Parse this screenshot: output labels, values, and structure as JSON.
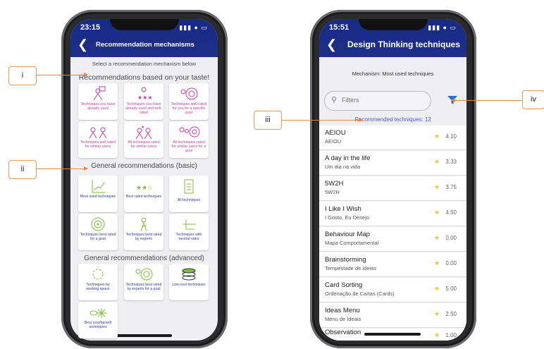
{
  "left": {
    "status_time": "23:15",
    "status_icons": "▮▮▮ ● ▭",
    "header_title": "Recommendation mechanisms",
    "intro": "Select a recommendation mechanism below",
    "section1": "Recommendations based on your taste!",
    "section2": "General recommendations (basic)",
    "section3": "General recommendations (advanced)",
    "cards1": [
      {
        "label": "Techniques you have already used",
        "icon": "person-list-icon"
      },
      {
        "label": "Techniques you have already used and well-rated",
        "icon": "person-stars-icon"
      },
      {
        "label": "Techniques well-rated for you for a specific goal",
        "icon": "person-target-icon"
      },
      {
        "label": "Techniques well-rated for similar users",
        "icon": "users-up-icon"
      },
      {
        "label": "All techniques rated for similar users",
        "icon": "users-stars-icon"
      },
      {
        "label": "All techniques rated for similar users for a goal",
        "icon": "users-target-icon"
      }
    ],
    "cards2": [
      {
        "label": "Most used techniques",
        "icon": "trend-chart-icon"
      },
      {
        "label": "Best rated techniques",
        "icon": "stars-icon"
      },
      {
        "label": "All techniques",
        "icon": "clipboard-list-icon"
      },
      {
        "label": "Techniques best rated for a goal",
        "icon": "target-icon"
      },
      {
        "label": "Techniques best rated by experts",
        "icon": "expert-icon"
      },
      {
        "label": "Techniques with neutral rates",
        "icon": "neutral-icon"
      }
    ],
    "cards3": [
      {
        "label": "Techniques by working space",
        "icon": "workspace-icon"
      },
      {
        "label": "Techniques best rated by experts for a goal",
        "icon": "experts-goal-icon"
      },
      {
        "label": "Low-cost techniques",
        "icon": "coins-icon"
      },
      {
        "label": "Best cost/benefit techniques",
        "icon": "cost-benefit-icon"
      }
    ]
  },
  "right": {
    "status_time": "15:51",
    "status_icons": "▮▮▮ ● ▭",
    "header_title": "Design Thinking techniques",
    "mechanism": "Mechanism: Most used techniques",
    "filter_placeholder": "Filters",
    "recommended": "Recommended techniques: 12",
    "rows": [
      {
        "name": "AEIOU",
        "sub": "AEIOU",
        "rating": "4.10"
      },
      {
        "name": "A day in the life",
        "sub": "Um dia na vida",
        "rating": "3.33"
      },
      {
        "name": "5W2H",
        "sub": "5W2H",
        "rating": "3.75"
      },
      {
        "name": "I Like I Wish",
        "sub": "I Gosto, Eu Desejo",
        "rating": "4.50"
      },
      {
        "name": "Behaviour Map",
        "sub": "Mapa Comportamental",
        "rating": "0.00"
      },
      {
        "name": "Brainstorming",
        "sub": "Tempestade de ideias",
        "rating": "0.00"
      },
      {
        "name": "Card Sorting",
        "sub": "Ordenação de Cartas (Cards)",
        "rating": "5.00"
      },
      {
        "name": "Ideas Menu",
        "sub": "Menu de Ideais",
        "rating": "2.50"
      },
      {
        "name": "Observation",
        "sub": "",
        "rating": "1.00"
      }
    ]
  },
  "annotations": {
    "i": "i",
    "ii": "ii",
    "iii": "iii",
    "iv": "iv"
  },
  "colors": {
    "header": "#1e2f86",
    "pink": "#c63aa8",
    "green": "#7bbf3a",
    "blue": "#2b3b9c",
    "accent_arrow": "#e9864a",
    "filter_blue": "#2f6bd6"
  }
}
